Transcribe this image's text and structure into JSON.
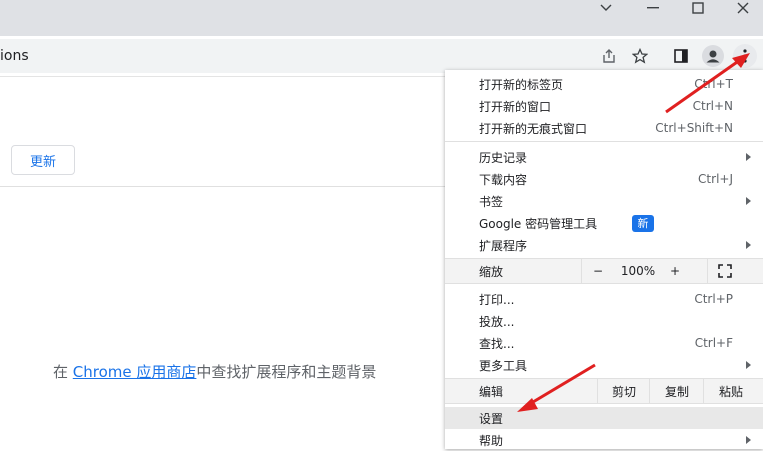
{
  "window": {
    "controls": [
      "chevron-down",
      "minimize",
      "maximize",
      "close"
    ]
  },
  "address_bar": {
    "text": "ions"
  },
  "page": {
    "update_button": "更新",
    "webstore": {
      "prefix": "在 ",
      "link": "Chrome 应用商店",
      "suffix": "中查找扩展程序和主题背景"
    }
  },
  "menu": {
    "new_tab": {
      "label": "打开新的标签页",
      "shortcut": "Ctrl+T"
    },
    "new_window": {
      "label": "打开新的窗口",
      "shortcut": "Ctrl+N"
    },
    "new_incognito": {
      "label": "打开新的无痕式窗口",
      "shortcut": "Ctrl+Shift+N"
    },
    "history": {
      "label": "历史记录"
    },
    "downloads": {
      "label": "下载内容",
      "shortcut": "Ctrl+J"
    },
    "bookmarks": {
      "label": "书签"
    },
    "password_manager": {
      "label": "Google 密码管理工具",
      "badge": "新"
    },
    "extensions": {
      "label": "扩展程序"
    },
    "zoom": {
      "label": "缩放",
      "minus": "−",
      "value": "100%",
      "plus": "+"
    },
    "print": {
      "label": "打印...",
      "shortcut": "Ctrl+P"
    },
    "cast": {
      "label": "投放..."
    },
    "find": {
      "label": "查找...",
      "shortcut": "Ctrl+F"
    },
    "more_tools": {
      "label": "更多工具"
    },
    "edit": {
      "label": "编辑",
      "cut": "剪切",
      "copy": "复制",
      "paste": "粘贴"
    },
    "settings": {
      "label": "设置"
    },
    "help": {
      "label": "帮助"
    }
  },
  "colors": {
    "accent": "#1a73e8",
    "arrow": "#e02020"
  }
}
